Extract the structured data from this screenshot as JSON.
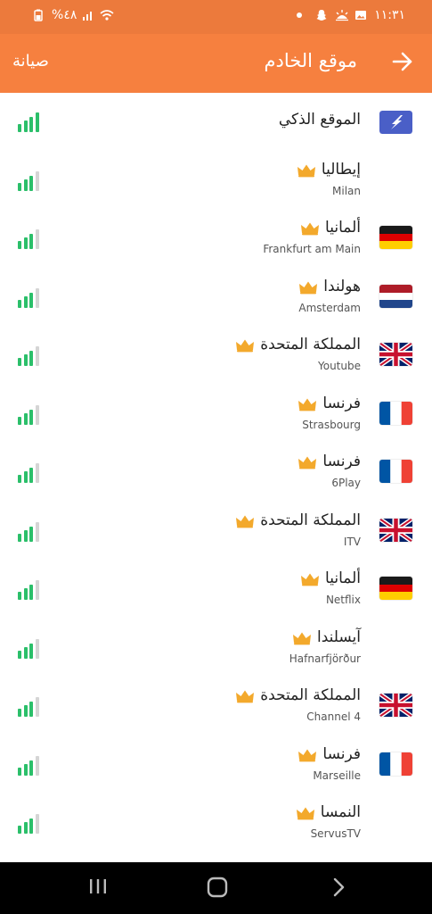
{
  "status_bar": {
    "time": "١١:٣١",
    "battery": "%٤٨",
    "left_icons": [
      "battery-icon",
      "signal-icon",
      "wifi-icon"
    ],
    "right_icons": [
      "gallery-icon",
      "weather-icon",
      "snapchat-icon",
      "dot-icon"
    ]
  },
  "header": {
    "title": "موقع الخادم",
    "maintenance_label": "صيانة",
    "back_icon": "arrow-icon"
  },
  "colors": {
    "status_bar": "#ec7a3c",
    "app_bar": "#f6803f",
    "signal_on": "#2bbf6a",
    "signal_off": "#d5d5d5",
    "crown": "#f3a92c"
  },
  "servers": [
    {
      "name": "الموقع الذكي",
      "sub": "",
      "flag": "smart",
      "premium": false,
      "signal": 4
    },
    {
      "name": "إيطاليا",
      "sub": "Milan",
      "flag": "none",
      "premium": true,
      "signal": 3
    },
    {
      "name": "ألمانيا",
      "sub": "Frankfurt am Main",
      "flag": "de",
      "premium": true,
      "signal": 3
    },
    {
      "name": "هولندا",
      "sub": "Amsterdam",
      "flag": "nl",
      "premium": true,
      "signal": 3
    },
    {
      "name": "المملكة المتحدة",
      "sub": "Youtube",
      "flag": "uk",
      "premium": true,
      "signal": 3
    },
    {
      "name": "فرنسا",
      "sub": "Strasbourg",
      "flag": "fr",
      "premium": true,
      "signal": 3
    },
    {
      "name": "فرنسا",
      "sub": "6Play",
      "flag": "fr",
      "premium": true,
      "signal": 3
    },
    {
      "name": "المملكة المتحدة",
      "sub": "ITV",
      "flag": "uk",
      "premium": true,
      "signal": 3
    },
    {
      "name": "ألمانيا",
      "sub": "Netflix",
      "flag": "de",
      "premium": true,
      "signal": 3
    },
    {
      "name": "آيسلندا",
      "sub": "Hafnarfjörður",
      "flag": "none",
      "premium": true,
      "signal": 3
    },
    {
      "name": "المملكة المتحدة",
      "sub": "Channel 4",
      "flag": "uk",
      "premium": true,
      "signal": 3
    },
    {
      "name": "فرنسا",
      "sub": "Marseille",
      "flag": "fr",
      "premium": true,
      "signal": 3
    },
    {
      "name": "النمسا",
      "sub": "ServusTV",
      "flag": "none",
      "premium": true,
      "signal": 3
    }
  ],
  "nav": {
    "recent_icon": "recent-apps-icon",
    "home_icon": "home-icon",
    "back_icon": "back-chevron-icon"
  }
}
